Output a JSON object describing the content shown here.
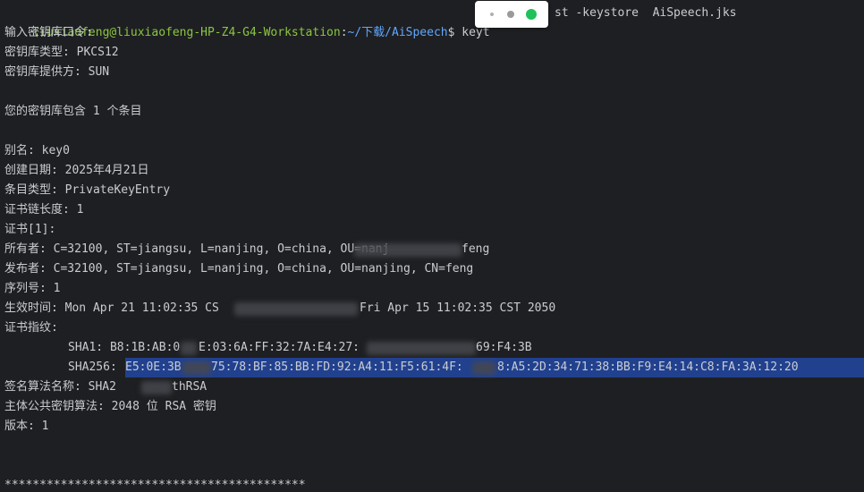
{
  "prompt": {
    "user_host": "liuxiaofeng@liuxiaofeng-HP-Z4-G4-Workstation",
    "separator": ":",
    "path": "~/下载/AiSpeech",
    "symbol": "$ ",
    "command_left": "keyt",
    "command_right": "st -keystore  AiSpeech.jks"
  },
  "lines": {
    "enter_password": "输入密钥库口令:",
    "keystore_type": "密钥库类型: PKCS12",
    "keystore_provider": "密钥库提供方: SUN",
    "keystore_contains": "您的密钥库包含 1 个条目",
    "alias": "别名: key0",
    "creation_date": "创建日期: 2025年4月21日",
    "entry_type": "条目类型: PrivateKeyEntry",
    "chain_length": "证书链长度: 1",
    "cert_index": "证书[1]:",
    "owner": "所有者: C=32100, ST=jiangsu, L=nanjing, O=china, OU=nanj",
    "owner_tail": "feng",
    "issuer": "发布者: C=32100, ST=jiangsu, L=nanjing, O=china, OU=nanjing, CN=feng",
    "serial": "序列号: 1",
    "validity": "生效时间: Mon Apr 21 11:02:35 CS",
    "validity_tail": "Fri Apr 15 11:02:35 CST 2050",
    "fingerprints": "证书指纹:",
    "sha1": "SHA1: B8:1B:AB:0",
    "sha1_mid": "E:03:6A:FF:32:7A:E4:27:",
    "sha1_tail": "69:F4:3B",
    "sha256": "SHA256: ",
    "sha256_a": "E5:0E:3B",
    "sha256_b": "75:78:BF:85:BB:FD:92:A4:11:F5:61:4F:",
    "sha256_c": "8:A5:2D:34:71:38:BB:F9:E4:14:C8:FA:3A:12:20",
    "sig_alg": "签名算法名称: SHA2",
    "sig_alg_tail": "thRSA",
    "pubkey": "主体公共密钥算法: 2048 位 RSA 密钥",
    "version": "版本: 1",
    "separator_stars": "*******************************************"
  },
  "colors": {
    "background": "#1e1f22",
    "text": "#c9ccd1",
    "prompt_user": "#8ac640",
    "prompt_path": "#5fa8ff",
    "selection": "#21418f",
    "popup_green": "#20c05c"
  },
  "icons": {
    "popup_dots": [
      "small-dot-icon",
      "gray-dot-icon",
      "green-dot-icon"
    ]
  }
}
